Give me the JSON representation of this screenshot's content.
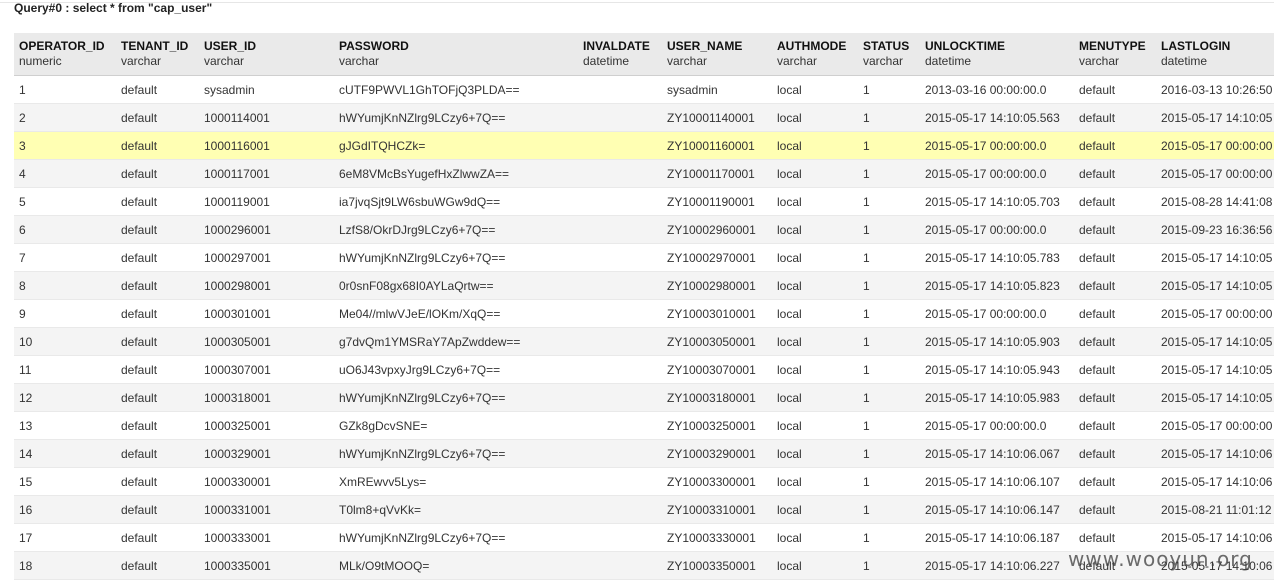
{
  "query": {
    "title": "Query#0 : select * from \"cap_user\""
  },
  "columns": [
    {
      "name": "OPERATOR_ID",
      "type": "numeric"
    },
    {
      "name": "TENANT_ID",
      "type": "varchar"
    },
    {
      "name": "USER_ID",
      "type": "varchar"
    },
    {
      "name": "PASSWORD",
      "type": "varchar"
    },
    {
      "name": "INVALDATE",
      "type": "datetime"
    },
    {
      "name": "USER_NAME",
      "type": "varchar"
    },
    {
      "name": "AUTHMODE",
      "type": "varchar"
    },
    {
      "name": "STATUS",
      "type": "varchar"
    },
    {
      "name": "UNLOCKTIME",
      "type": "datetime"
    },
    {
      "name": "MENUTYPE",
      "type": "varchar"
    },
    {
      "name": "LASTLOGIN",
      "type": "datetime"
    }
  ],
  "selected_row": 2,
  "rows": [
    [
      "1",
      "default",
      "sysadmin",
      "cUTF9PWVL1GhTOFjQ3PLDA==",
      "",
      "sysadmin",
      "local",
      "1",
      "2013-03-16 00:00:00.0",
      "default",
      "2016-03-13 10:26:50"
    ],
    [
      "2",
      "default",
      "1000114001",
      "hWYumjKnNZlrg9LCzy6+7Q==",
      "",
      "ZY10001140001",
      "local",
      "1",
      "2015-05-17 14:10:05.563",
      "default",
      "2015-05-17 14:10:05"
    ],
    [
      "3",
      "default",
      "1000116001",
      "gJGdITQHCZk=",
      "",
      "ZY10001160001",
      "local",
      "1",
      "2015-05-17 00:00:00.0",
      "default",
      "2015-05-17 00:00:00"
    ],
    [
      "4",
      "default",
      "1000117001",
      "6eM8VMcBsYugefHxZlwwZA==",
      "",
      "ZY10001170001",
      "local",
      "1",
      "2015-05-17 00:00:00.0",
      "default",
      "2015-05-17 00:00:00"
    ],
    [
      "5",
      "default",
      "1000119001",
      "ia7jvqSjt9LW6sbuWGw9dQ==",
      "",
      "ZY10001190001",
      "local",
      "1",
      "2015-05-17 14:10:05.703",
      "default",
      "2015-08-28 14:41:08"
    ],
    [
      "6",
      "default",
      "1000296001",
      "LzfS8/OkrDJrg9LCzy6+7Q==",
      "",
      "ZY10002960001",
      "local",
      "1",
      "2015-05-17 00:00:00.0",
      "default",
      "2015-09-23 16:36:56"
    ],
    [
      "7",
      "default",
      "1000297001",
      "hWYumjKnNZlrg9LCzy6+7Q==",
      "",
      "ZY10002970001",
      "local",
      "1",
      "2015-05-17 14:10:05.783",
      "default",
      "2015-05-17 14:10:05"
    ],
    [
      "8",
      "default",
      "1000298001",
      "0r0snF08gx68I0AYLaQrtw==",
      "",
      "ZY10002980001",
      "local",
      "1",
      "2015-05-17 14:10:05.823",
      "default",
      "2015-05-17 14:10:05"
    ],
    [
      "9",
      "default",
      "1000301001",
      "Me04//mlwVJeE/lOKm/XqQ==",
      "",
      "ZY10003010001",
      "local",
      "1",
      "2015-05-17 00:00:00.0",
      "default",
      "2015-05-17 00:00:00"
    ],
    [
      "10",
      "default",
      "1000305001",
      "g7dvQm1YMSRaY7ApZwddew==",
      "",
      "ZY10003050001",
      "local",
      "1",
      "2015-05-17 14:10:05.903",
      "default",
      "2015-05-17 14:10:05"
    ],
    [
      "11",
      "default",
      "1000307001",
      "uO6J43vpxyJrg9LCzy6+7Q==",
      "",
      "ZY10003070001",
      "local",
      "1",
      "2015-05-17 14:10:05.943",
      "default",
      "2015-05-17 14:10:05"
    ],
    [
      "12",
      "default",
      "1000318001",
      "hWYumjKnNZlrg9LCzy6+7Q==",
      "",
      "ZY10003180001",
      "local",
      "1",
      "2015-05-17 14:10:05.983",
      "default",
      "2015-05-17 14:10:05"
    ],
    [
      "13",
      "default",
      "1000325001",
      "GZk8gDcvSNE=",
      "",
      "ZY10003250001",
      "local",
      "1",
      "2015-05-17 00:00:00.0",
      "default",
      "2015-05-17 00:00:00"
    ],
    [
      "14",
      "default",
      "1000329001",
      "hWYumjKnNZlrg9LCzy6+7Q==",
      "",
      "ZY10003290001",
      "local",
      "1",
      "2015-05-17 14:10:06.067",
      "default",
      "2015-05-17 14:10:06"
    ],
    [
      "15",
      "default",
      "1000330001",
      "XmREwvv5Lys=",
      "",
      "ZY10003300001",
      "local",
      "1",
      "2015-05-17 14:10:06.107",
      "default",
      "2015-05-17 14:10:06"
    ],
    [
      "16",
      "default",
      "1000331001",
      "T0lm8+qVvKk=",
      "",
      "ZY10003310001",
      "local",
      "1",
      "2015-05-17 14:10:06.147",
      "default",
      "2015-08-21 11:01:12"
    ],
    [
      "17",
      "default",
      "1000333001",
      "hWYumjKnNZlrg9LCzy6+7Q==",
      "",
      "ZY10003330001",
      "local",
      "1",
      "2015-05-17 14:10:06.187",
      "default",
      "2015-05-17 14:10:06"
    ],
    [
      "18",
      "default",
      "1000335001",
      "MLk/O9tMOOQ=",
      "",
      "ZY10003350001",
      "local",
      "1",
      "2015-05-17 14:10:06.227",
      "default",
      "2015-05-17 14:10:06"
    ]
  ],
  "watermark": "www.wooyun.org"
}
